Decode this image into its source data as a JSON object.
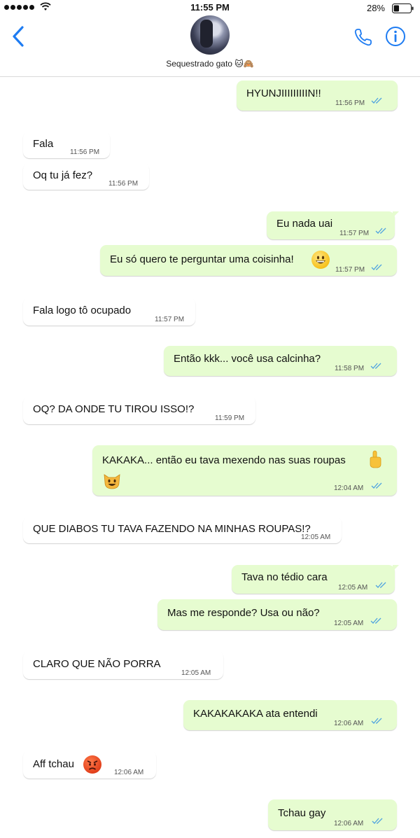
{
  "status_bar": {
    "time": "11:55 PM",
    "battery": "28%"
  },
  "header": {
    "contact_name": "Sequestrado gato 🐱🙈"
  },
  "messages": [
    {
      "side": "out",
      "text": "HYUNJIIIIIIIIIN!!",
      "time": "11:56 PM"
    },
    {
      "side": "in",
      "text": "Fala",
      "time": "11:56 PM"
    },
    {
      "side": "in",
      "text": "Oq tu já fez?",
      "time": "11:56 PM"
    },
    {
      "side": "out",
      "text": "Eu nada uai",
      "time": "11:57 PM"
    },
    {
      "side": "out",
      "text": "Eu só quero te perguntar uma coisinha!",
      "time": "11:57 PM",
      "emoji": "grinning-face"
    },
    {
      "side": "in",
      "text": "Fala logo tô ocupado",
      "time": "11:57 PM"
    },
    {
      "side": "out",
      "text": "Então kkk... você usa calcinha?",
      "time": "11:58 PM"
    },
    {
      "side": "in",
      "text": "OQ? DA ONDE TU TIROU ISSO!?",
      "time": "11:59 PM"
    },
    {
      "side": "out",
      "text": "KAKAKA... então eu tava mexendo nas suas roupas",
      "time": "12:04 AM",
      "emoji": "pointing-up-hand",
      "emoji2": "grinning-cat"
    },
    {
      "side": "in",
      "text": "QUE DIABOS TU TAVA FAZENDO NA MINHAS ROUPAS!?",
      "time": "12:05 AM"
    },
    {
      "side": "out",
      "text": "Tava no tédio cara",
      "time": "12:05 AM"
    },
    {
      "side": "out",
      "text": "Mas me responde? Usa ou não?",
      "time": "12:05 AM"
    },
    {
      "side": "in",
      "text": "CLARO QUE NÃO PORRA",
      "time": "12:05 AM"
    },
    {
      "side": "out",
      "text": "KAKAKAKAKA ata entendi",
      "time": "12:06 AM"
    },
    {
      "side": "in",
      "text": "Aff tchau",
      "time": "12:06 AM",
      "emoji": "angry-face"
    },
    {
      "side": "out",
      "text": "Tchau gay",
      "time": "12:06 AM"
    }
  ],
  "colors": {
    "accent": "#1e7cf2",
    "outgoing_bubble": "#e6fcd0",
    "incoming_bubble": "#ffffff",
    "read_check": "#4fa3e0"
  }
}
